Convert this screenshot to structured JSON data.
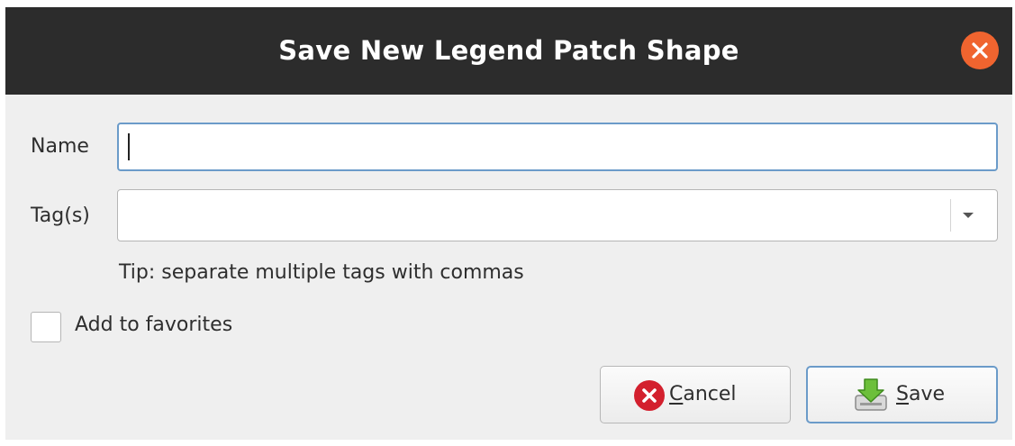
{
  "window": {
    "title": "Save New Legend Patch Shape",
    "close_icon": "close-icon"
  },
  "form": {
    "name_label": "Name",
    "name_value": "",
    "tags_label": "Tag(s)",
    "tags_value": "",
    "tip": "Tip: separate multiple tags with commas",
    "favorites_label": "Add to favorites",
    "favorites_checked": false
  },
  "buttons": {
    "cancel_mnemonic": "C",
    "cancel_rest": "ancel",
    "cancel_icon": "cancel-icon",
    "save_mnemonic": "S",
    "save_rest": "ave",
    "save_icon": "save-icon"
  },
  "colors": {
    "titlebar": "#2c2c2c",
    "close": "#f0642f",
    "focus_border": "#6b9bc9",
    "cancel_icon": "#d3202e",
    "save_icon": "#6cbf3a"
  }
}
